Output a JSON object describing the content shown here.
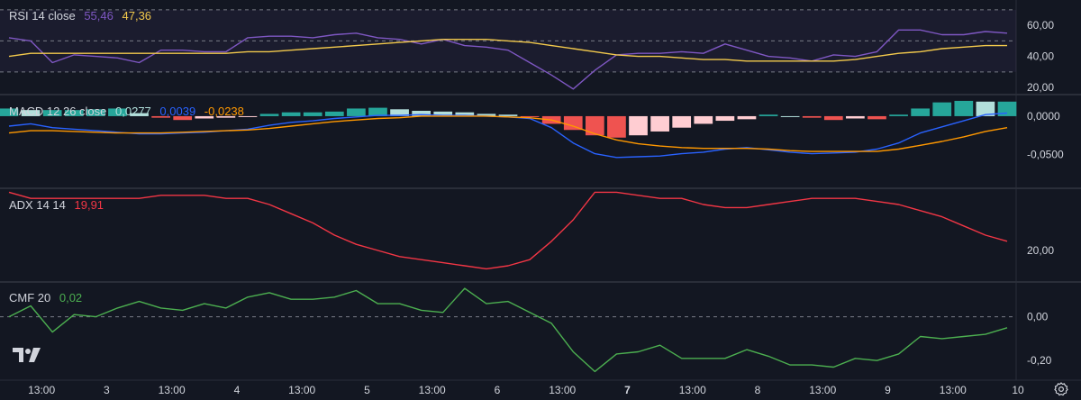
{
  "chart_data": [
    {
      "type": "line",
      "id": "rsi",
      "title": "RSI 14 close",
      "values_shown": [
        "55,46",
        "47,36"
      ],
      "y_ticks": [
        {
          "v": 60,
          "label": "60,00"
        },
        {
          "v": 40,
          "label": "40,00"
        },
        {
          "v": 20,
          "label": "20,00"
        }
      ],
      "ylim": [
        16,
        74
      ],
      "bands": [
        70,
        50,
        30
      ],
      "series": [
        {
          "color": "#7e57c2",
          "values": [
            52,
            50,
            36,
            41,
            40,
            39,
            36,
            44,
            44,
            43,
            43,
            52,
            53,
            53,
            52,
            54,
            55,
            52,
            51,
            48,
            51,
            47,
            46,
            44,
            36,
            28,
            19,
            31,
            41,
            42,
            42,
            43,
            42,
            48,
            44,
            40,
            39,
            37,
            41,
            40,
            43,
            57,
            57,
            54,
            54,
            56,
            55
          ]
        },
        {
          "color": "#f2c94c",
          "values": [
            40,
            42,
            42,
            42,
            42,
            42,
            42,
            42,
            42,
            42,
            42,
            43,
            43,
            44,
            45,
            46,
            47,
            48,
            49,
            50,
            51,
            51,
            51,
            50,
            49,
            47,
            45,
            43,
            41,
            40,
            40,
            39,
            38,
            38,
            37,
            37,
            37,
            37,
            37,
            38,
            40,
            42,
            43,
            45,
            46,
            47,
            47
          ]
        }
      ]
    },
    {
      "type": "bar",
      "id": "macd",
      "title": "MACD 12 26 close",
      "values_shown": [
        "0,0277",
        "0,0039",
        "-0,0238"
      ],
      "y_ticks": [
        {
          "v": 0,
          "label": "0,0000"
        },
        {
          "v": -0.05,
          "label": "-0,0500"
        }
      ],
      "ylim": [
        -0.093,
        0.027
      ],
      "colors": {
        "up_strong": "#26a69a",
        "up_weak": "#b2dfdb",
        "down_strong": "#ef5350",
        "down_weak": "#ffcdd2"
      },
      "histogram": [
        0.01,
        0.008,
        0.008,
        0.008,
        0.009,
        0.01,
        0.004,
        -0.002,
        -0.005,
        -0.003,
        -0.002,
        -0.001,
        0.003,
        0.005,
        0.005,
        0.006,
        0.01,
        0.011,
        0.009,
        0.007,
        0.006,
        0.005,
        0.003,
        0.002,
        -0.001,
        -0.01,
        -0.018,
        -0.025,
        -0.028,
        -0.025,
        -0.02,
        -0.015,
        -0.01,
        -0.006,
        -0.004,
        0.002,
        0.0,
        -0.002,
        -0.005,
        -0.003,
        -0.004,
        0.002,
        0.01,
        0.018,
        0.02,
        0.019,
        0.019
      ],
      "series": [
        {
          "color": "#2962ff",
          "values": [
            -0.013,
            -0.01,
            -0.015,
            -0.017,
            -0.019,
            -0.021,
            -0.023,
            -0.023,
            -0.022,
            -0.021,
            -0.019,
            -0.017,
            -0.012,
            -0.008,
            -0.006,
            -0.003,
            -0.001,
            0.001,
            0.001,
            0.002,
            0.001,
            0.001,
            0.0,
            -0.001,
            -0.003,
            -0.015,
            -0.035,
            -0.049,
            -0.054,
            -0.053,
            -0.052,
            -0.049,
            -0.047,
            -0.043,
            -0.041,
            -0.044,
            -0.047,
            -0.049,
            -0.048,
            -0.047,
            -0.043,
            -0.035,
            -0.022,
            -0.014,
            -0.006,
            0.002,
            0.004
          ]
        },
        {
          "color": "#ff9800",
          "values": [
            -0.022,
            -0.019,
            -0.019,
            -0.02,
            -0.021,
            -0.022,
            -0.022,
            -0.022,
            -0.021,
            -0.02,
            -0.019,
            -0.018,
            -0.016,
            -0.013,
            -0.01,
            -0.007,
            -0.005,
            -0.003,
            -0.002,
            0.0,
            0.0,
            0.0,
            0.0,
            -0.001,
            -0.002,
            -0.005,
            -0.013,
            -0.023,
            -0.031,
            -0.036,
            -0.039,
            -0.041,
            -0.042,
            -0.042,
            -0.042,
            -0.043,
            -0.045,
            -0.046,
            -0.046,
            -0.046,
            -0.046,
            -0.043,
            -0.038,
            -0.033,
            -0.027,
            -0.02,
            -0.015
          ]
        }
      ]
    },
    {
      "type": "line",
      "id": "adx",
      "title": "ADX 14 14",
      "values_shown": [
        "19,91"
      ],
      "y_ticks": [
        {
          "v": 20,
          "label": "20,00"
        }
      ],
      "ylim": [
        10,
        40
      ],
      "series": [
        {
          "color": "#f23645",
          "values": [
            39,
            37,
            37,
            37,
            37,
            37,
            37,
            38,
            38,
            38,
            37,
            37,
            35,
            32,
            29,
            25,
            22,
            20,
            18,
            17,
            16,
            15,
            14,
            15,
            17,
            23,
            30,
            39,
            39,
            38,
            37,
            37,
            35,
            34,
            34,
            35,
            36,
            37,
            37,
            37,
            36,
            35,
            33,
            31,
            28,
            25,
            23
          ]
        }
      ]
    },
    {
      "type": "line",
      "id": "cmf",
      "title": "CMF 20",
      "values_shown": [
        "0,02"
      ],
      "y_ticks": [
        {
          "v": 0,
          "label": "0,00"
        },
        {
          "v": -0.2,
          "label": "-0,20"
        }
      ],
      "ylim": [
        -0.265,
        0.155
      ],
      "zero_line": true,
      "series": [
        {
          "color": "#4caf50",
          "values": [
            0.0,
            0.05,
            -0.07,
            0.01,
            0.0,
            0.04,
            0.07,
            0.04,
            0.03,
            0.06,
            0.04,
            0.09,
            0.11,
            0.08,
            0.08,
            0.09,
            0.12,
            0.06,
            0.06,
            0.03,
            0.02,
            0.13,
            0.06,
            0.07,
            0.02,
            -0.03,
            -0.16,
            -0.25,
            -0.17,
            -0.16,
            -0.13,
            -0.19,
            -0.19,
            -0.19,
            -0.15,
            -0.18,
            -0.22,
            -0.22,
            -0.23,
            -0.19,
            -0.2,
            -0.17,
            -0.09,
            -0.1,
            -0.09,
            -0.08,
            -0.05
          ]
        }
      ]
    }
  ],
  "x_axis": {
    "ticks": [
      {
        "i": 1.5,
        "label": "13:00",
        "bold": false
      },
      {
        "i": 4.5,
        "label": "3",
        "bold": false
      },
      {
        "i": 7.5,
        "label": "13:00",
        "bold": false
      },
      {
        "i": 10.5,
        "label": "4",
        "bold": false
      },
      {
        "i": 13.5,
        "label": "13:00",
        "bold": false
      },
      {
        "i": 16.5,
        "label": "5",
        "bold": false
      },
      {
        "i": 19.5,
        "label": "13:00",
        "bold": false
      },
      {
        "i": 22.5,
        "label": "6",
        "bold": false
      },
      {
        "i": 25.5,
        "label": "13:00",
        "bold": false
      },
      {
        "i": 28.5,
        "label": "7",
        "bold": true
      },
      {
        "i": 31.5,
        "label": "13:00",
        "bold": false
      },
      {
        "i": 34.5,
        "label": "8",
        "bold": false
      },
      {
        "i": 37.5,
        "label": "13:00",
        "bold": false
      },
      {
        "i": 40.5,
        "label": "9",
        "bold": false
      },
      {
        "i": 43.5,
        "label": "13:00",
        "bold": false
      },
      {
        "i": 46.5,
        "label": "10",
        "bold": false
      }
    ]
  },
  "colors": {
    "background": "#131722",
    "rsi_band_fill": "rgba(126,87,194,0.08)",
    "separator": "#2a2e39",
    "dashed": "#787b86"
  },
  "icons": {
    "logo": "tradingview-logo-icon",
    "settings": "gear-icon"
  }
}
